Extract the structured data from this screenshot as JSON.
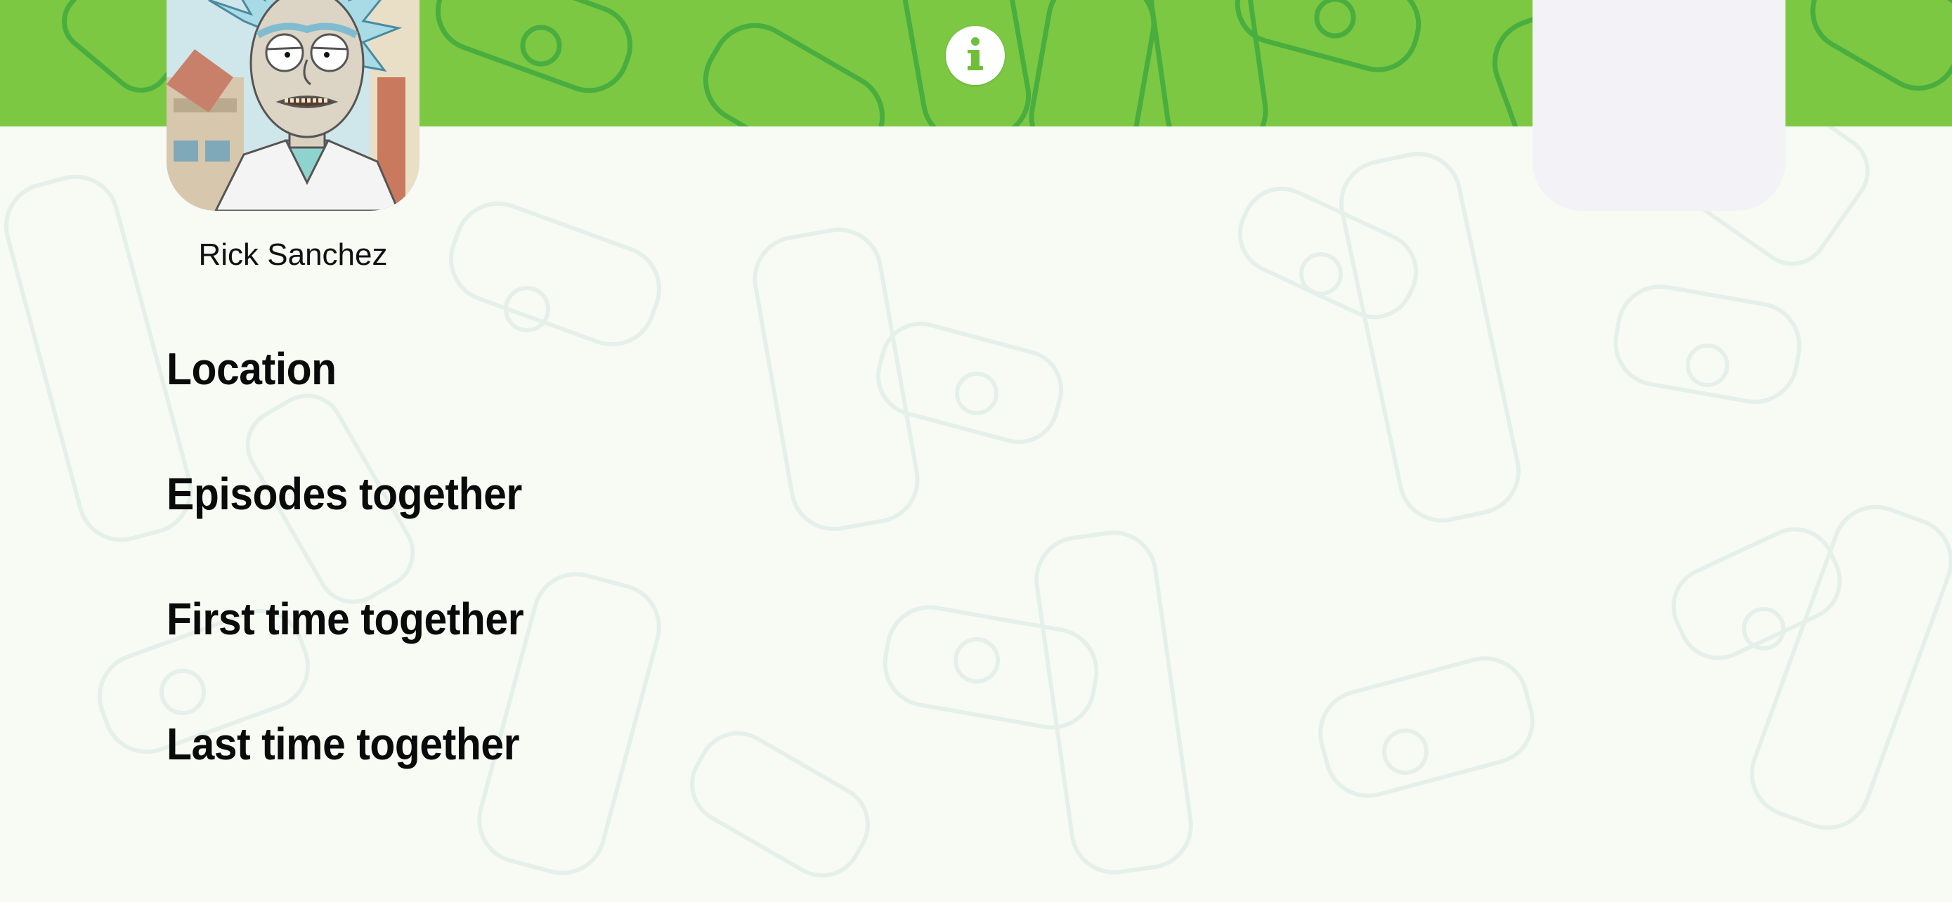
{
  "header": {
    "background_color": "#7cc843",
    "info_icon": "info-icon",
    "info_icon_color": "#6fbf3a"
  },
  "character": {
    "name": "Rick Sanchez"
  },
  "sections": {
    "location": "Location",
    "episodes_together": "Episodes together",
    "first_time_together": "First time together",
    "last_time_together": "Last time together"
  },
  "colors": {
    "page_background": "#f8fbf4",
    "placeholder_card": "#f2f2f7",
    "heading_text": "#0a0a0a"
  }
}
